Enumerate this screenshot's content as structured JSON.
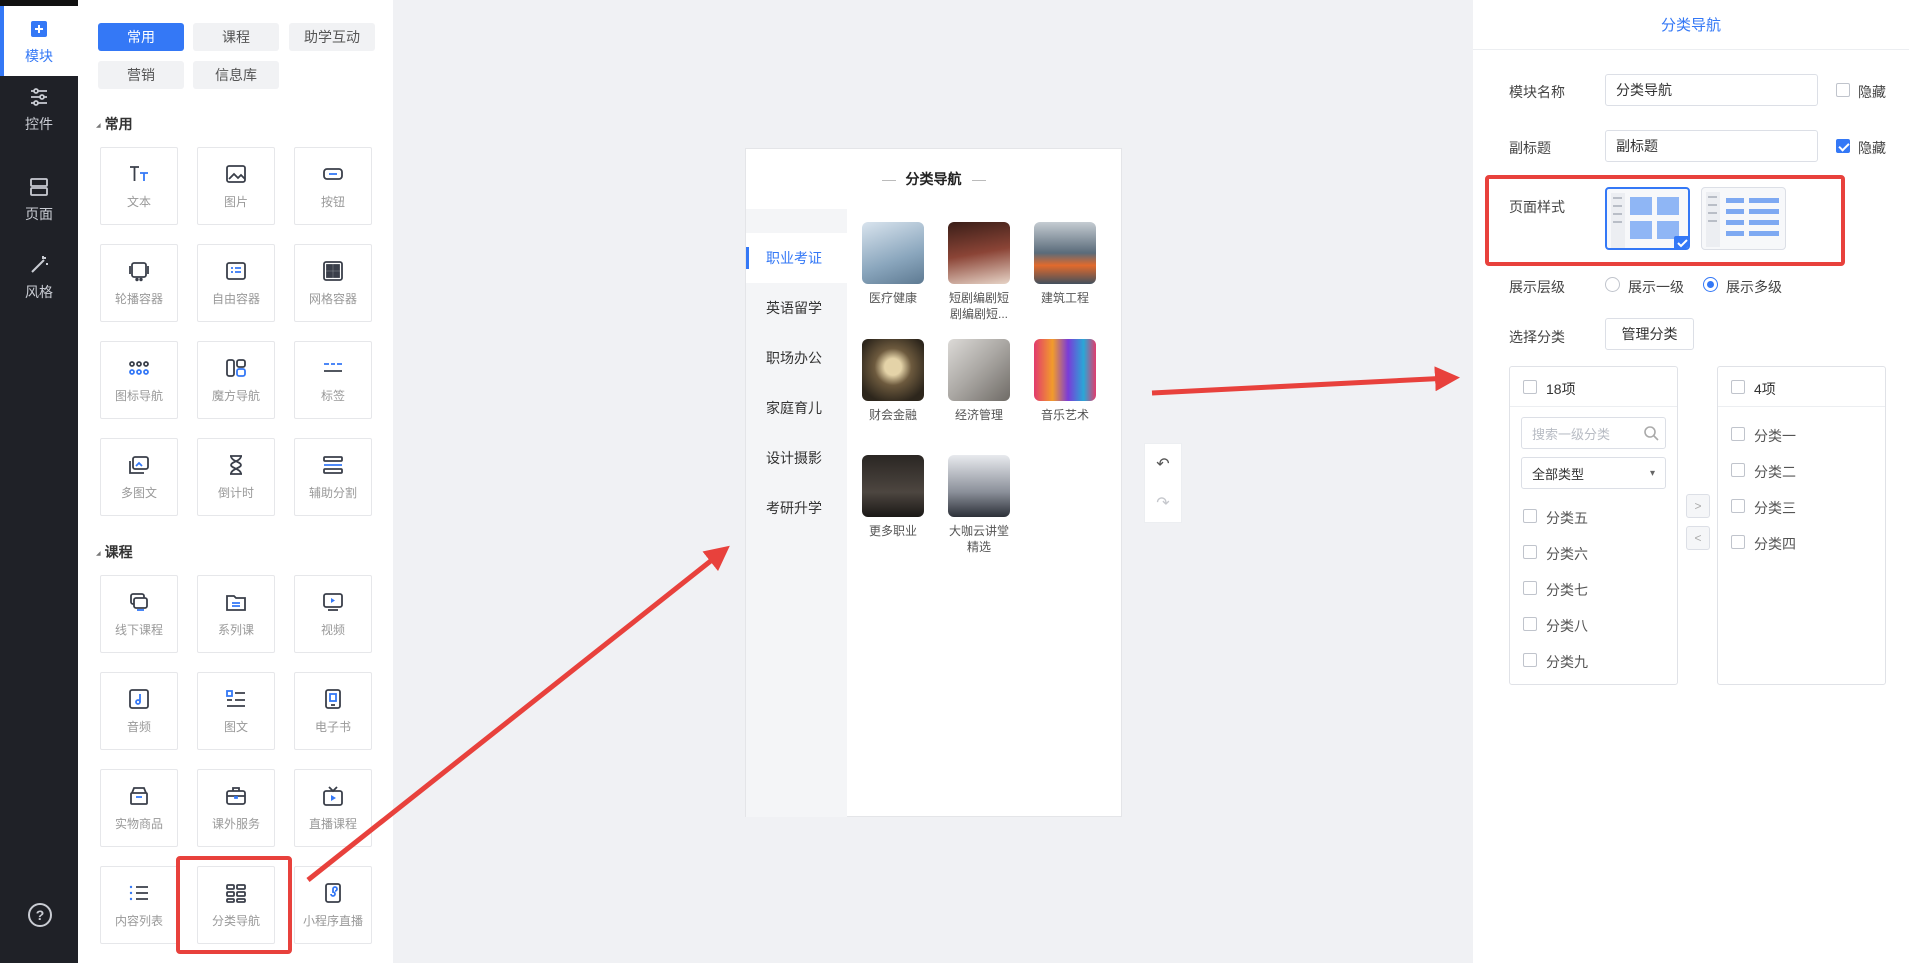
{
  "rail": {
    "items": [
      {
        "label": "模块",
        "icon": "plus-square-icon",
        "active": true
      },
      {
        "label": "控件",
        "icon": "sliders-icon",
        "active": false
      },
      {
        "label": "页面",
        "icon": "page-layout-icon",
        "active": false
      },
      {
        "label": "风格",
        "icon": "magic-wand-icon",
        "active": false
      }
    ],
    "help": "?"
  },
  "panel": {
    "chips": [
      {
        "label": "常用",
        "active": true
      },
      {
        "label": "课程",
        "active": false
      },
      {
        "label": "助学互动",
        "active": false
      },
      {
        "label": "营销",
        "active": false
      },
      {
        "label": "信息库",
        "active": false
      }
    ],
    "section_common": "常用",
    "section_course": "课程",
    "common_tiles": [
      {
        "label": "文本",
        "icon": "text-icon"
      },
      {
        "label": "图片",
        "icon": "image-icon"
      },
      {
        "label": "按钮",
        "icon": "button-icon"
      },
      {
        "label": "轮播容器",
        "icon": "carousel-icon"
      },
      {
        "label": "自由容器",
        "icon": "free-container-icon"
      },
      {
        "label": "网格容器",
        "icon": "grid-container-icon"
      },
      {
        "label": "图标导航",
        "icon": "icon-nav-icon"
      },
      {
        "label": "魔方导航",
        "icon": "cube-nav-icon"
      },
      {
        "label": "标签",
        "icon": "tag-icon"
      },
      {
        "label": "多图文",
        "icon": "multi-image-text-icon"
      },
      {
        "label": "倒计时",
        "icon": "hourglass-icon"
      },
      {
        "label": "辅助分割",
        "icon": "divider-icon"
      }
    ],
    "course_tiles": [
      {
        "label": "线下课程",
        "icon": "offline-course-icon"
      },
      {
        "label": "系列课",
        "icon": "series-course-icon"
      },
      {
        "label": "视频",
        "icon": "video-icon"
      },
      {
        "label": "音频",
        "icon": "audio-icon"
      },
      {
        "label": "图文",
        "icon": "image-text-icon"
      },
      {
        "label": "电子书",
        "icon": "ebook-icon"
      },
      {
        "label": "实物商品",
        "icon": "product-icon"
      },
      {
        "label": "课外服务",
        "icon": "service-icon"
      },
      {
        "label": "直播课程",
        "icon": "live-tv-icon"
      },
      {
        "label": "内容列表",
        "icon": "content-list-icon"
      },
      {
        "label": "分类导航",
        "icon": "category-nav-icon"
      },
      {
        "label": "小程序直播",
        "icon": "mini-program-live-icon"
      }
    ]
  },
  "preview": {
    "title": "分类导航",
    "tabs": [
      "职业考证",
      "英语留学",
      "职场办公",
      "家庭育儿",
      "设计摄影",
      "考研升学"
    ],
    "active_tab": 0,
    "categories": [
      {
        "label": "医疗健康",
        "color": "#9fb4c8"
      },
      {
        "label": "短剧编剧短剧编剧短...",
        "color": "#7a3b2f"
      },
      {
        "label": "建筑工程",
        "color": "#5a6b7a"
      },
      {
        "label": "财会金融",
        "color": "#6d5a3e"
      },
      {
        "label": "经济管理",
        "color": "#a9a6a2"
      },
      {
        "label": "音乐艺术",
        "color": "#c0487a"
      },
      {
        "label": "更多职业",
        "color": "#3f3a36"
      },
      {
        "label": "大咖云讲堂精选",
        "color": "#8a8f99"
      }
    ],
    "undo": "↶",
    "redo": "↷"
  },
  "settings": {
    "title": "分类导航",
    "module_name_label": "模块名称",
    "module_name_value": "分类导航",
    "hide_label": "隐藏",
    "hide_module_name": false,
    "subtitle_label": "副标题",
    "subtitle_value": "副标题",
    "hide_subtitle": true,
    "page_style_label": "页面样式",
    "page_style_selected": 0,
    "level_label": "展示层级",
    "level_options": [
      "展示一级",
      "展示多级"
    ],
    "level_selected": 1,
    "select_cat_label": "选择分类",
    "manage_btn": "管理分类",
    "left_count": "18项",
    "search_placeholder": "搜索一级分类",
    "type_select": "全部类型",
    "left_items": [
      "分类五",
      "分类六",
      "分类七",
      "分类八",
      "分类九"
    ],
    "right_count": "4项",
    "right_items": [
      "分类一",
      "分类二",
      "分类三",
      "分类四"
    ],
    "move_right": ">",
    "move_left": "<"
  },
  "colors": {
    "accent": "#3478f6",
    "highlight": "#e8413c",
    "rail": "#1f2127"
  }
}
